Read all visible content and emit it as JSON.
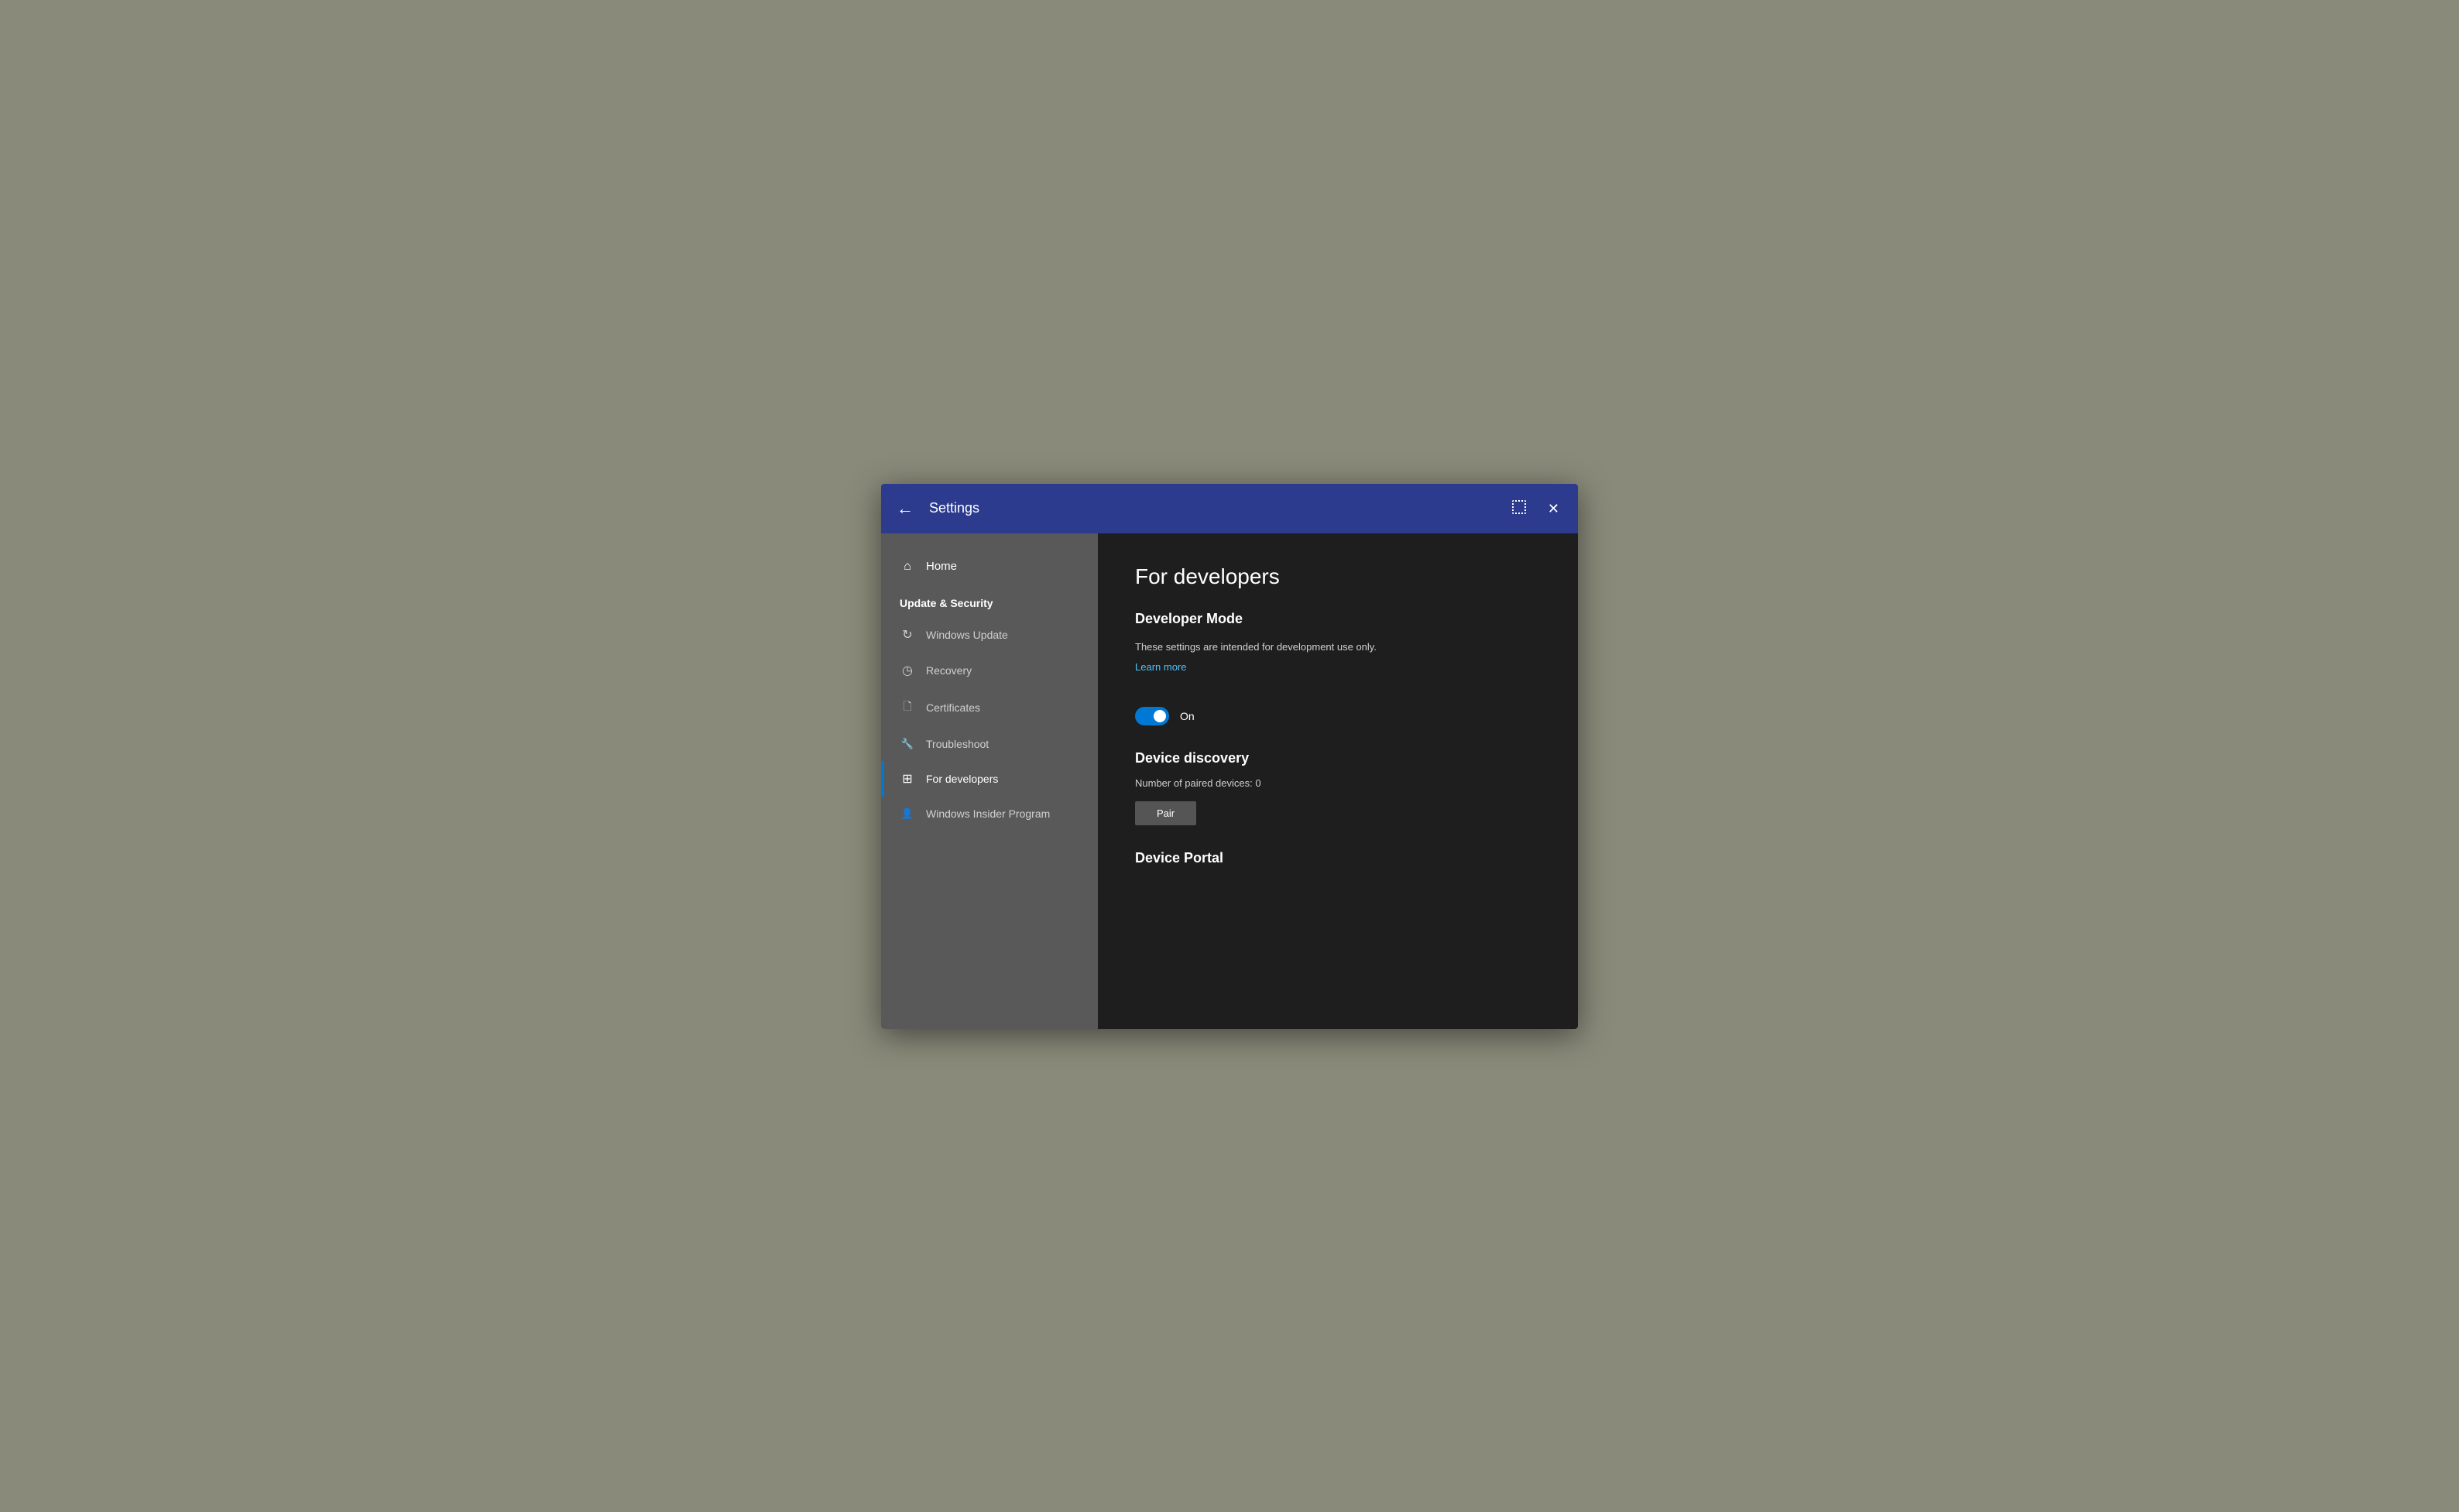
{
  "titlebar": {
    "back_label": "←",
    "title": "Settings",
    "close_label": "✕"
  },
  "sidebar": {
    "home_label": "Home",
    "section_label": "Update & Security",
    "items": [
      {
        "id": "windows-update",
        "label": "Windows Update",
        "icon": "update"
      },
      {
        "id": "recovery",
        "label": "Recovery",
        "icon": "recovery"
      },
      {
        "id": "certificates",
        "label": "Certificates",
        "icon": "cert"
      },
      {
        "id": "troubleshoot",
        "label": "Troubleshoot",
        "icon": "troubleshoot"
      },
      {
        "id": "for-developers",
        "label": "For developers",
        "icon": "developer",
        "active": true
      },
      {
        "id": "windows-insider",
        "label": "Windows Insider Program",
        "icon": "insider"
      }
    ]
  },
  "main": {
    "page_title": "For developers",
    "developer_mode": {
      "section_title": "Developer Mode",
      "description": "These settings are intended for development use only.",
      "learn_more": "Learn more",
      "toggle_state": "On"
    },
    "device_discovery": {
      "section_title": "Device discovery",
      "paired_devices_label": "Number of paired devices: 0",
      "pair_button_label": "Pair"
    },
    "device_portal": {
      "section_title": "Device Portal"
    }
  }
}
